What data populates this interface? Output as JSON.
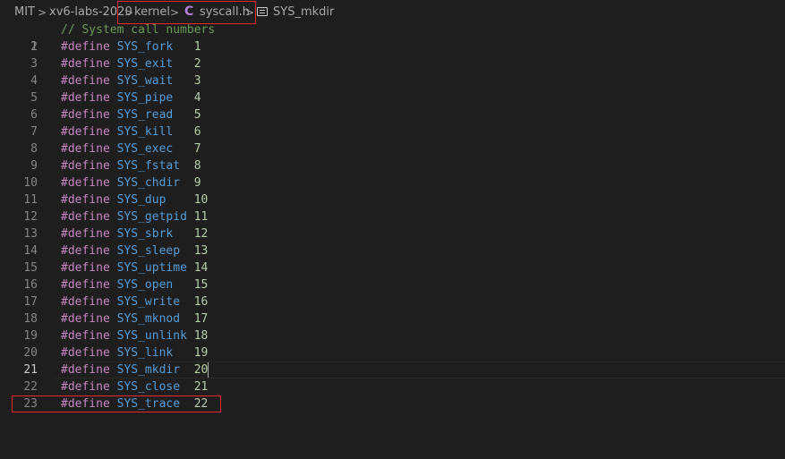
{
  "breadcrumbs": {
    "items": [
      "MIT",
      "xv6-labs-2020",
      "kernel",
      "syscall.h",
      "SYS_mkdir"
    ],
    "separator": ">"
  },
  "file": {
    "language_icon": "C",
    "current_line": 21
  },
  "code": {
    "comment": "// System call numbers",
    "define_keyword": "#define",
    "lines": [
      {
        "n": "1"
      },
      {
        "n": "2",
        "name": "SYS_fork",
        "value": "1"
      },
      {
        "n": "3",
        "name": "SYS_exit",
        "value": "2"
      },
      {
        "n": "4",
        "name": "SYS_wait",
        "value": "3"
      },
      {
        "n": "5",
        "name": "SYS_pipe",
        "value": "4"
      },
      {
        "n": "6",
        "name": "SYS_read",
        "value": "5"
      },
      {
        "n": "7",
        "name": "SYS_kill",
        "value": "6"
      },
      {
        "n": "8",
        "name": "SYS_exec",
        "value": "7"
      },
      {
        "n": "9",
        "name": "SYS_fstat",
        "value": "8"
      },
      {
        "n": "10",
        "name": "SYS_chdir",
        "value": "9"
      },
      {
        "n": "11",
        "name": "SYS_dup",
        "value": "10"
      },
      {
        "n": "12",
        "name": "SYS_getpid",
        "value": "11"
      },
      {
        "n": "13",
        "name": "SYS_sbrk",
        "value": "12"
      },
      {
        "n": "14",
        "name": "SYS_sleep",
        "value": "13"
      },
      {
        "n": "15",
        "name": "SYS_uptime",
        "value": "14"
      },
      {
        "n": "16",
        "name": "SYS_open",
        "value": "15"
      },
      {
        "n": "17",
        "name": "SYS_write",
        "value": "16"
      },
      {
        "n": "18",
        "name": "SYS_mknod",
        "value": "17"
      },
      {
        "n": "19",
        "name": "SYS_unlink",
        "value": "18"
      },
      {
        "n": "20",
        "name": "SYS_link",
        "value": "19"
      },
      {
        "n": "21",
        "name": "SYS_mkdir",
        "value": "20"
      },
      {
        "n": "22",
        "name": "SYS_close",
        "value": "21"
      },
      {
        "n": "23",
        "name": "SYS_trace",
        "value": "22"
      }
    ]
  },
  "colors": {
    "background": "#1e1e1e",
    "keyword": "#c586c0",
    "macro": "#569cd6",
    "number": "#b5cea8",
    "comment": "#6a9955",
    "line_number": "#858585",
    "highlight_box": "#e8262b"
  }
}
